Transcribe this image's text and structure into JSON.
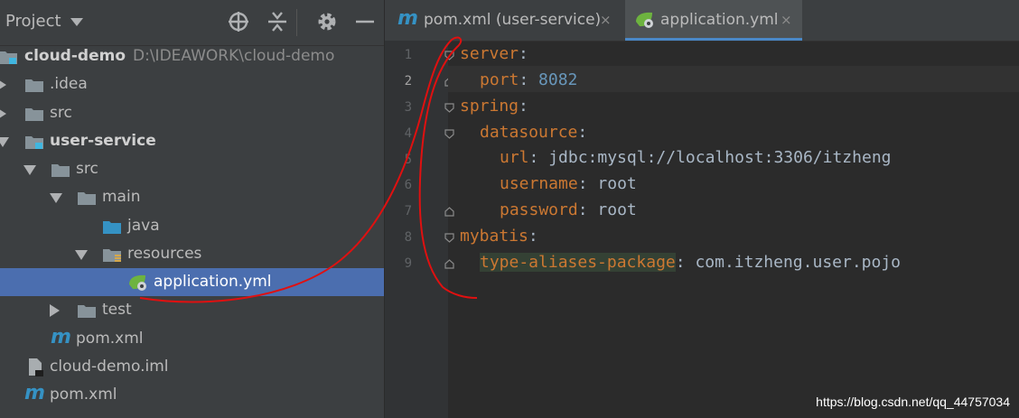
{
  "project_panel": {
    "title": "Project",
    "tree": [
      {
        "label": "cloud-demo",
        "path": "D:\\IDEAWORK\\cloud-demo"
      },
      {
        "label": ".idea"
      },
      {
        "label": "src"
      },
      {
        "label": "user-service"
      },
      {
        "label": "src"
      },
      {
        "label": "main"
      },
      {
        "label": "java"
      },
      {
        "label": "resources"
      },
      {
        "label": "application.yml"
      },
      {
        "label": "test"
      },
      {
        "label": "pom.xml"
      },
      {
        "label": "cloud-demo.iml"
      },
      {
        "label": "pom.xml"
      }
    ]
  },
  "editor": {
    "tabs": [
      {
        "label": "pom.xml (user-service)",
        "close": "×"
      },
      {
        "label": "application.yml",
        "close": "×"
      }
    ],
    "line_numbers": [
      "1",
      "2",
      "3",
      "4",
      "5",
      "6",
      "7",
      "8",
      "9"
    ],
    "code": [
      {
        "key": "server",
        "sep": ":",
        "value": ""
      },
      {
        "key": "port",
        "sep": ": ",
        "value": "8082"
      },
      {
        "key": "spring",
        "sep": ":",
        "value": ""
      },
      {
        "key": "datasource",
        "sep": ":",
        "value": ""
      },
      {
        "key": "url",
        "sep": ": ",
        "value": "jdbc:mysql://localhost:3306/itzheng"
      },
      {
        "key": "username",
        "sep": ": ",
        "value": "root"
      },
      {
        "key": "password",
        "sep": ": ",
        "value": "root"
      },
      {
        "key": "mybatis",
        "sep": ":",
        "value": ""
      },
      {
        "key": "type-aliases-package",
        "sep": ": ",
        "value": "com.itzheng.user.pojo"
      }
    ]
  },
  "watermark": "https://blog.csdn.net/qq_44757034",
  "colors": {
    "selection": "#4b6eaf",
    "yaml_key": "#cc7832",
    "number": "#6897bb",
    "annotation": "#e01010"
  }
}
